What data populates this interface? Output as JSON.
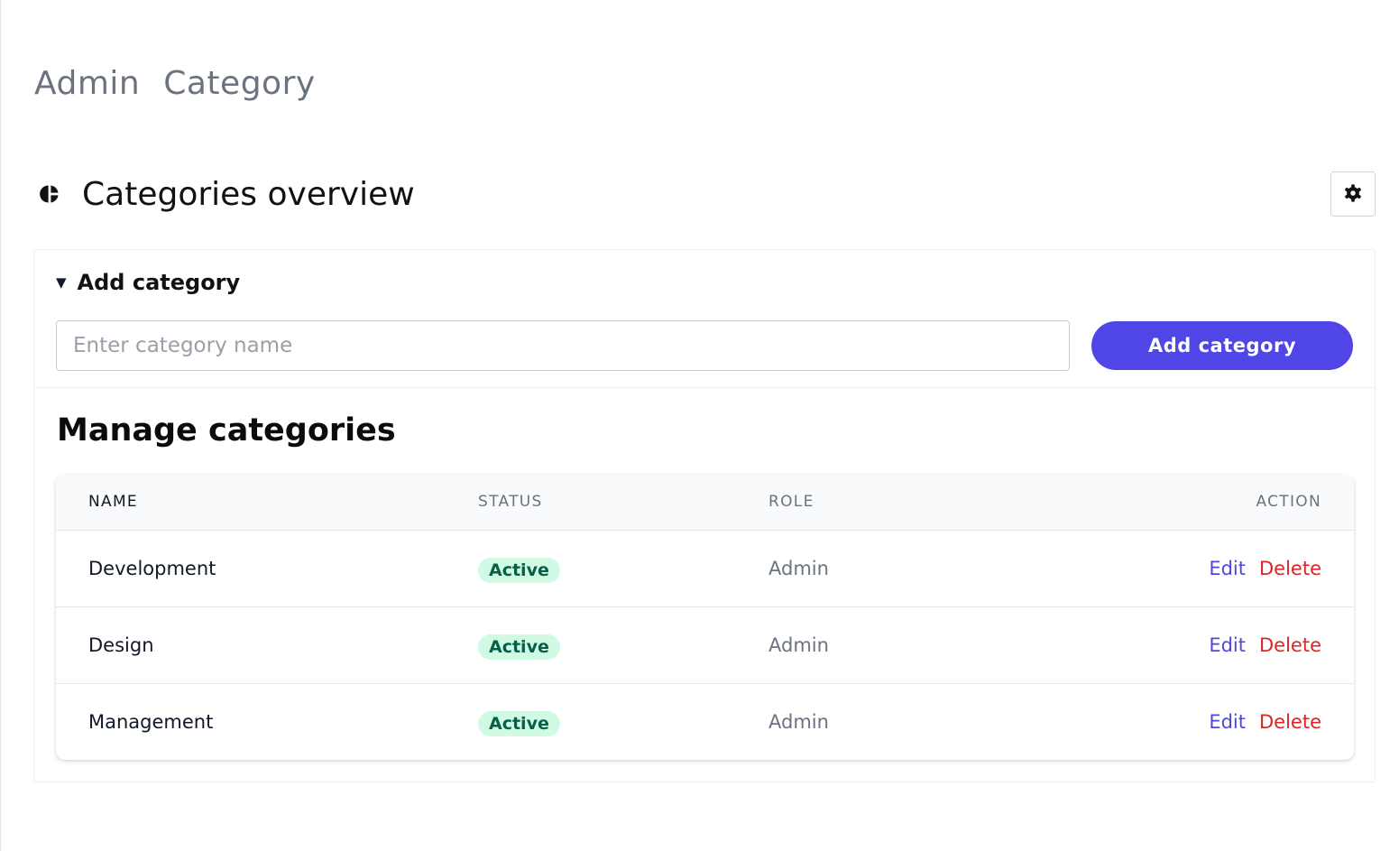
{
  "breadcrumb": [
    "Admin",
    "Category"
  ],
  "header": {
    "title": "Categories overview",
    "icon": "pie-chart-icon",
    "settings_icon": "gear-icon"
  },
  "add_section": {
    "summary_label": "Add category",
    "input_placeholder": "Enter category name",
    "input_value": "",
    "button_label": "Add category"
  },
  "manage": {
    "title": "Manage categories",
    "columns": [
      "NAME",
      "STATUS",
      "ROLE",
      "ACTION"
    ],
    "rows": [
      {
        "name": "Development",
        "status": "Active",
        "role": "Admin",
        "edit": "Edit",
        "delete": "Delete"
      },
      {
        "name": "Design",
        "status": "Active",
        "role": "Admin",
        "edit": "Edit",
        "delete": "Delete"
      },
      {
        "name": "Management",
        "status": "Active",
        "role": "Admin",
        "edit": "Edit",
        "delete": "Delete"
      }
    ]
  },
  "colors": {
    "accent": "#4f46e5",
    "danger": "#dc2626",
    "badge_bg": "#d1fae5",
    "badge_text": "#065f46"
  }
}
